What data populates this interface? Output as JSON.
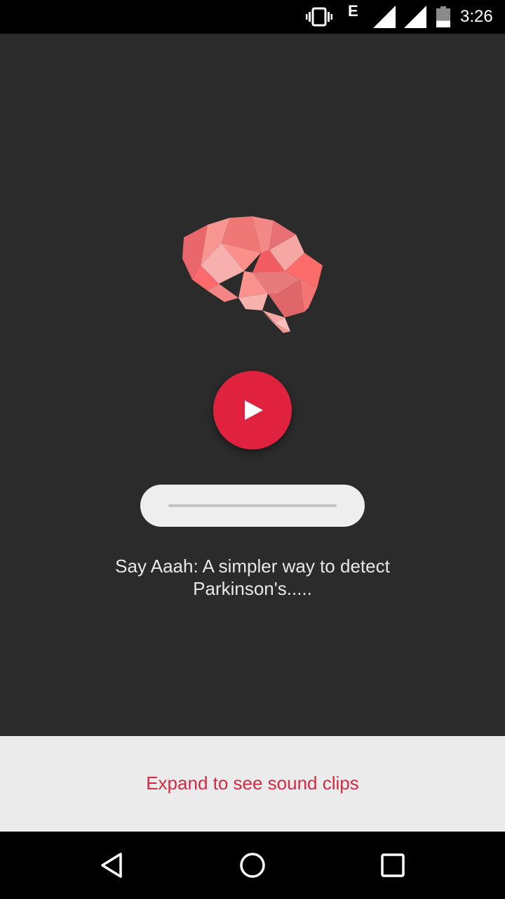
{
  "status_bar": {
    "network_type": "E",
    "time": "3:26",
    "icons": [
      "vibrate-icon",
      "signal-icon",
      "signal-icon",
      "battery-icon"
    ],
    "battery_level": 0.35
  },
  "player": {
    "play_icon": "play-icon",
    "progress": 0.0
  },
  "description": {
    "line1": "Say Aaah: A simpler way to detect",
    "line2": "Parkinson's....."
  },
  "bottom_sheet": {
    "label": "Expand to see sound clips"
  },
  "nav_bar": {
    "icons": [
      "back-icon",
      "home-icon",
      "recents-icon"
    ]
  },
  "colors": {
    "background": "#2b2b2b",
    "accent": "#e0223f",
    "accent_text": "#d62a44",
    "sheet": "#ebebeb",
    "brain_base": "#f07a78"
  }
}
